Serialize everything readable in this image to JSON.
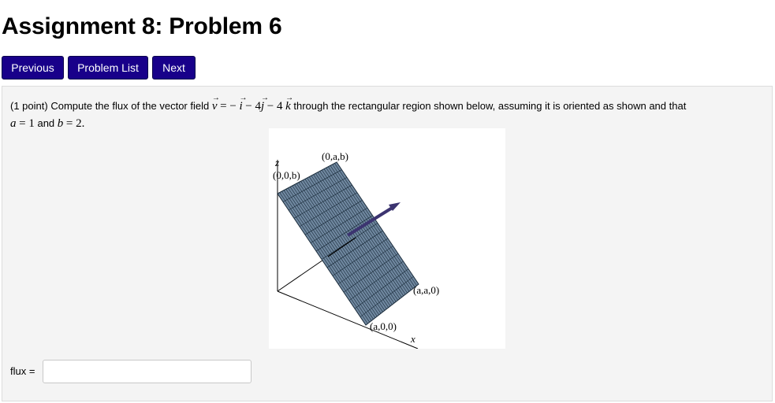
{
  "page": {
    "title": "Assignment 8: Problem 6"
  },
  "nav": {
    "previous_label": "Previous",
    "problem_list_label": "Problem List",
    "next_label": "Next"
  },
  "problem": {
    "points": "(1 point)",
    "text_before_field": "Compute the flux of the vector field",
    "text_after_field": "through the rectangular region shown below, assuming it is oriented as shown and that",
    "field_parts": {
      "v": "v",
      "equals_minus": "= −",
      "i": "i",
      "minus4_j": "− 4",
      "j": "j",
      "minus4_k": "− 4",
      "k": "k"
    },
    "condition": {
      "a_var": "a",
      "a_eq": "= 1",
      "and": "and",
      "b_var": "b",
      "b_eq": "= 2."
    }
  },
  "figure": {
    "labels": {
      "z_axis": "z",
      "x_axis": "x",
      "p00b": "(0,0,b)",
      "p0ab": "(0,a,b)",
      "paa0": "(a,a,0)",
      "pa00": "(a,0,0)"
    },
    "colors": {
      "surface": "#6f879f",
      "grid": "#1a2b3a",
      "arrow": "#3c3470"
    }
  },
  "answer": {
    "label": "flux =",
    "value": "",
    "placeholder": ""
  },
  "colors": {
    "nav_button": "#18008a",
    "problem_background": "#f4f4f4"
  }
}
